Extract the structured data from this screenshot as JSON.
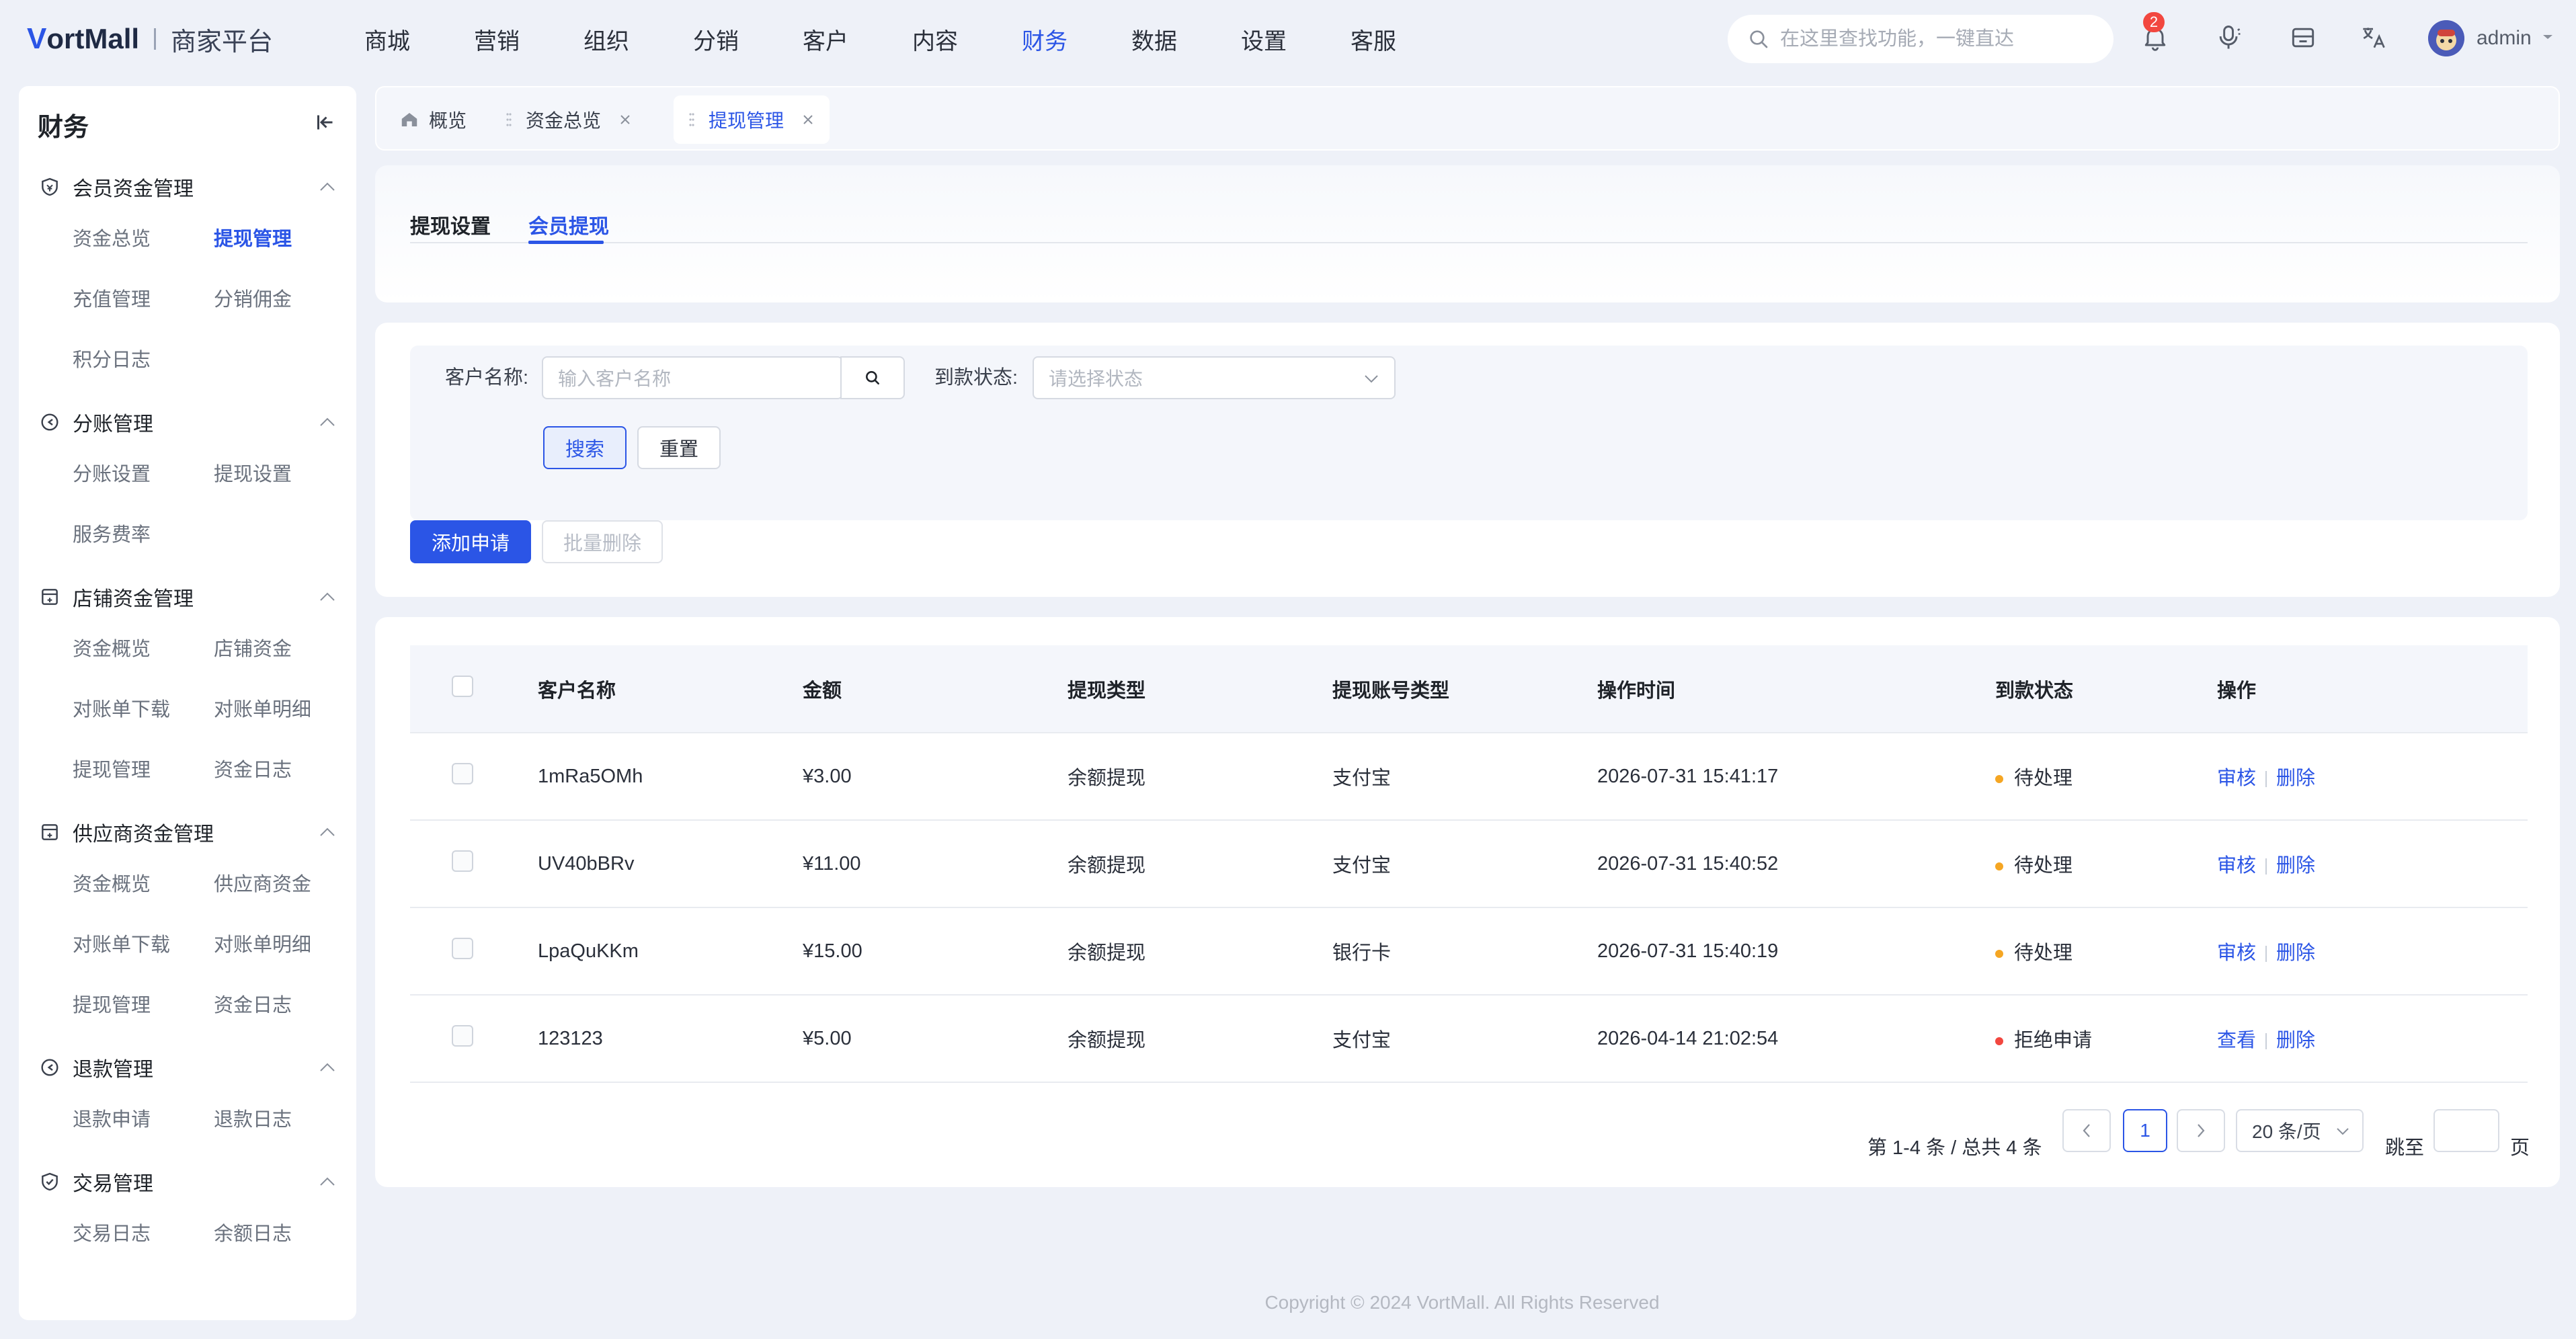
{
  "brand": {
    "logo_mark": "V",
    "logo_text": "ortMall",
    "subtitle": "商家平台"
  },
  "topnav": [
    "商城",
    "营销",
    "组织",
    "分销",
    "客户",
    "内容",
    "财务",
    "数据",
    "设置",
    "客服"
  ],
  "topnav_active": "财务",
  "search": {
    "placeholder": "在这里查找功能，一键直达"
  },
  "notifications": {
    "count": "2"
  },
  "user": {
    "name": "admin"
  },
  "sidebar": {
    "title": "财务",
    "groups": [
      {
        "label": "会员资金管理",
        "items": [
          "资金总览",
          "提现管理",
          "充值管理",
          "分销佣金",
          "积分日志"
        ]
      },
      {
        "label": "分账管理",
        "items": [
          "分账设置",
          "提现设置",
          "服务费率"
        ]
      },
      {
        "label": "店铺资金管理",
        "items": [
          "资金概览",
          "店铺资金",
          "对账单下载",
          "对账单明细",
          "提现管理",
          "资金日志"
        ]
      },
      {
        "label": "供应商资金管理",
        "items": [
          "资金概览",
          "供应商资金",
          "对账单下载",
          "对账单明细",
          "提现管理",
          "资金日志"
        ]
      },
      {
        "label": "退款管理",
        "items": [
          "退款申请",
          "退款日志"
        ]
      },
      {
        "label": "交易管理",
        "items": [
          "交易日志",
          "余额日志"
        ]
      }
    ]
  },
  "tabs": [
    {
      "label": "概览"
    },
    {
      "label": "资金总览"
    },
    {
      "label": "提现管理"
    }
  ],
  "subtabs": [
    "提现设置",
    "会员提现"
  ],
  "filters": {
    "customer_label": "客户名称:",
    "customer_placeholder": "输入客户名称",
    "status_label": "到款状态:",
    "status_placeholder": "请选择状态",
    "search_btn": "搜索",
    "reset_btn": "重置"
  },
  "actions": {
    "add": "添加申请",
    "batch_delete": "批量删除"
  },
  "table": {
    "columns": [
      "客户名称",
      "金额",
      "提现类型",
      "提现账号类型",
      "操作时间",
      "到款状态",
      "操作"
    ],
    "rows": [
      {
        "name": "1mRa5OMh",
        "amount": "¥3.00",
        "type": "余额提现",
        "account": "支付宝",
        "time": "2026-07-31 15:41:17",
        "status": "待处理",
        "status_color": "#f5a623",
        "op1": "审核",
        "op2": "删除"
      },
      {
        "name": "UV40bBRv",
        "amount": "¥11.00",
        "type": "余额提现",
        "account": "支付宝",
        "time": "2026-07-31 15:40:52",
        "status": "待处理",
        "status_color": "#f5a623",
        "op1": "审核",
        "op2": "删除"
      },
      {
        "name": "LpaQuKKm",
        "amount": "¥15.00",
        "type": "余额提现",
        "account": "银行卡",
        "time": "2026-07-31 15:40:19",
        "status": "待处理",
        "status_color": "#f5a623",
        "op1": "审核",
        "op2": "删除"
      },
      {
        "name": "123123",
        "amount": "¥5.00",
        "type": "余额提现",
        "account": "支付宝",
        "time": "2026-04-14 21:02:54",
        "status": "拒绝申请",
        "status_color": "#f2473f",
        "op1": "查看",
        "op2": "删除"
      }
    ]
  },
  "pagination": {
    "summary": "第 1-4 条 / 总共 4 条",
    "current": "1",
    "page_size": "20 条/页",
    "jump_label": "跳至",
    "page_suffix": "页"
  },
  "footer": "Copyright © 2024 VortMall. All Rights Reserved",
  "colors": {
    "accent": "#2b55e6",
    "pending": "#f5a623",
    "rejected": "#f2473f"
  }
}
